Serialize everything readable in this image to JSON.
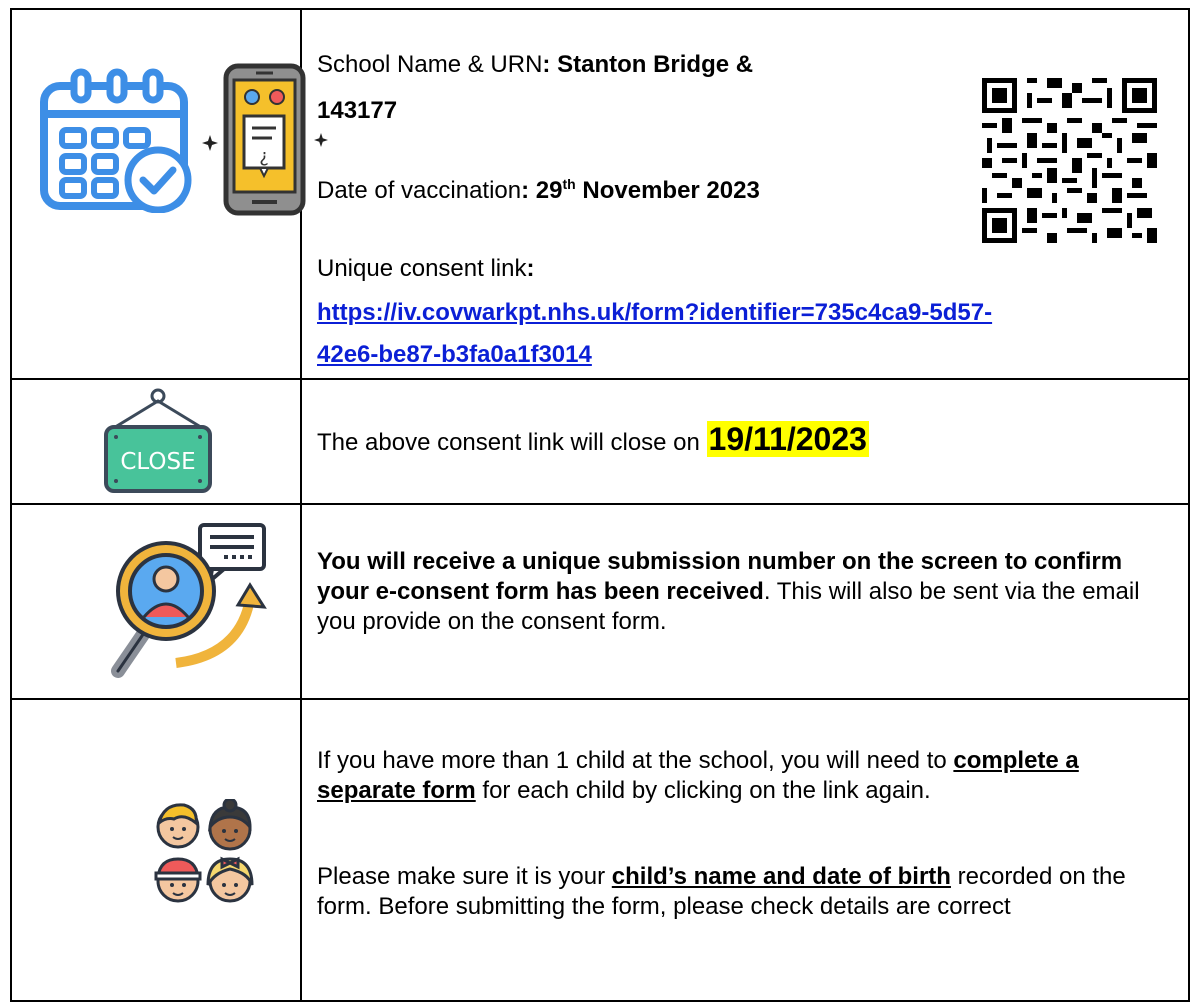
{
  "row1": {
    "school_label": "School Name & URN",
    "school_colon": ":",
    "school_value_line1": "Stanton Bridge &",
    "school_value_line2": "143177",
    "date_label": "Date of vaccination",
    "date_colon": ":",
    "date_day": "29",
    "date_suffix": "th",
    "date_rest": "November 2023",
    "consent_label": "Unique consent link",
    "consent_colon": ":",
    "consent_link_line1": "https://iv.covwarkpt.nhs.uk/form?identifier=735c4ca9-5d57-",
    "consent_link_line2": "42e6-be87-b3fa0a1f3014"
  },
  "row2": {
    "sign_text": "CLOSE",
    "text": "The above consent link will close on",
    "close_date": "19/11/2023"
  },
  "row3": {
    "bold_text": "You will receive a unique submission number on the screen to confirm your e-consent form has been received",
    "rest_text": ". This will also be sent via the email you provide on the consent form."
  },
  "row4": {
    "p1_start": "If you have more than 1 child at the school, you will need to",
    "p1_underlined": "complete a separate form",
    "p1_end": "for each child by clicking on the link again.",
    "p2_start": "Please make sure it is your",
    "p2_underlined": "child’s name and date of birth",
    "p2_end": "recorded on the form. Before submitting the form, please check details are correct"
  },
  "colors": {
    "link": "#0b1fd6",
    "highlight": "#ffff00",
    "sign_green": "#48c39a",
    "calendar_blue": "#3d8ee6"
  }
}
